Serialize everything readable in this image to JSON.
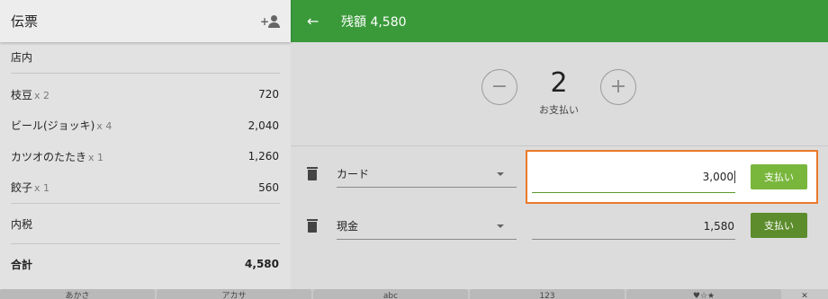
{
  "left_panel": {
    "title": "伝票",
    "section": "店内",
    "items": [
      {
        "name": "枝豆",
        "qty": "x 2",
        "price": "720"
      },
      {
        "name": "ビール(ジョッキ)",
        "qty": "x 4",
        "price": "2,040"
      },
      {
        "name": "カツオのたたき",
        "qty": "x 1",
        "price": "1,260"
      },
      {
        "name": "餃子",
        "qty": "x 1",
        "price": "560"
      }
    ],
    "tax_label": "内税",
    "total_label": "合計",
    "total_value": "4,580"
  },
  "topbar": {
    "title": "残額 4,580"
  },
  "split": {
    "count": "2",
    "caption": "お支払い",
    "minus_symbol": "−",
    "plus_symbol": "+"
  },
  "payments": [
    {
      "method": "カード",
      "amount": "3,000",
      "button": "支払い"
    },
    {
      "method": "現金",
      "amount": "1,580",
      "button": "支払い"
    }
  ],
  "keyboard": {
    "keys": [
      "あかさ",
      "アカサ",
      "abc",
      "123",
      "♥☆★",
      "✕"
    ]
  },
  "colors": {
    "topbar": "#3a9a3a",
    "pay_button_active": "#79b63c",
    "pay_button": "#5c8c2c",
    "highlight_border": "#ea7a2a"
  }
}
